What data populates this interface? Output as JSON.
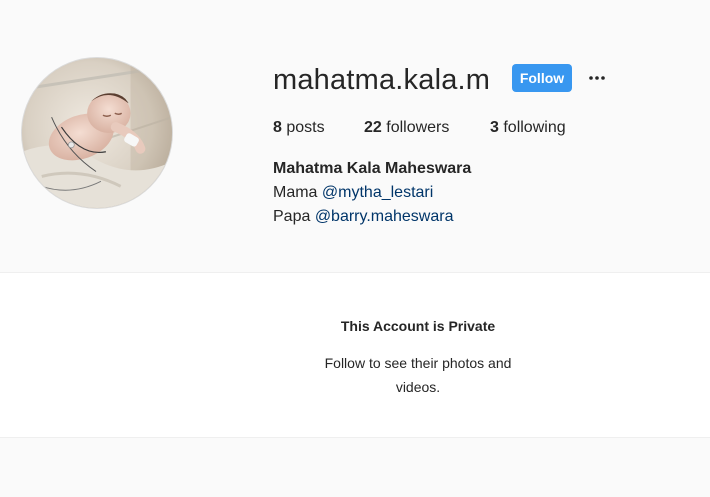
{
  "profile": {
    "username": "mahatma.kala.m",
    "follow_label": "Follow",
    "options_icon": "more-horizontal-icon",
    "colors": {
      "follow_button": "#3897f0",
      "mention_link": "#003569",
      "background": "#fafafa"
    },
    "stats": {
      "posts_count": "8",
      "posts_label": " posts",
      "followers_count": "22",
      "followers_label": " followers",
      "following_count": "3",
      "following_label": " following"
    },
    "full_name": "Mahatma Kala Maheswara",
    "bio": [
      {
        "prefix": "Mama ",
        "mention": "@mytha_lestari"
      },
      {
        "prefix": "Papa ",
        "mention": "@barry.maheswara"
      }
    ]
  },
  "private_notice": {
    "title": "This Account is Private",
    "text_line1": "Follow to see their photos and",
    "text_line2": "videos."
  }
}
